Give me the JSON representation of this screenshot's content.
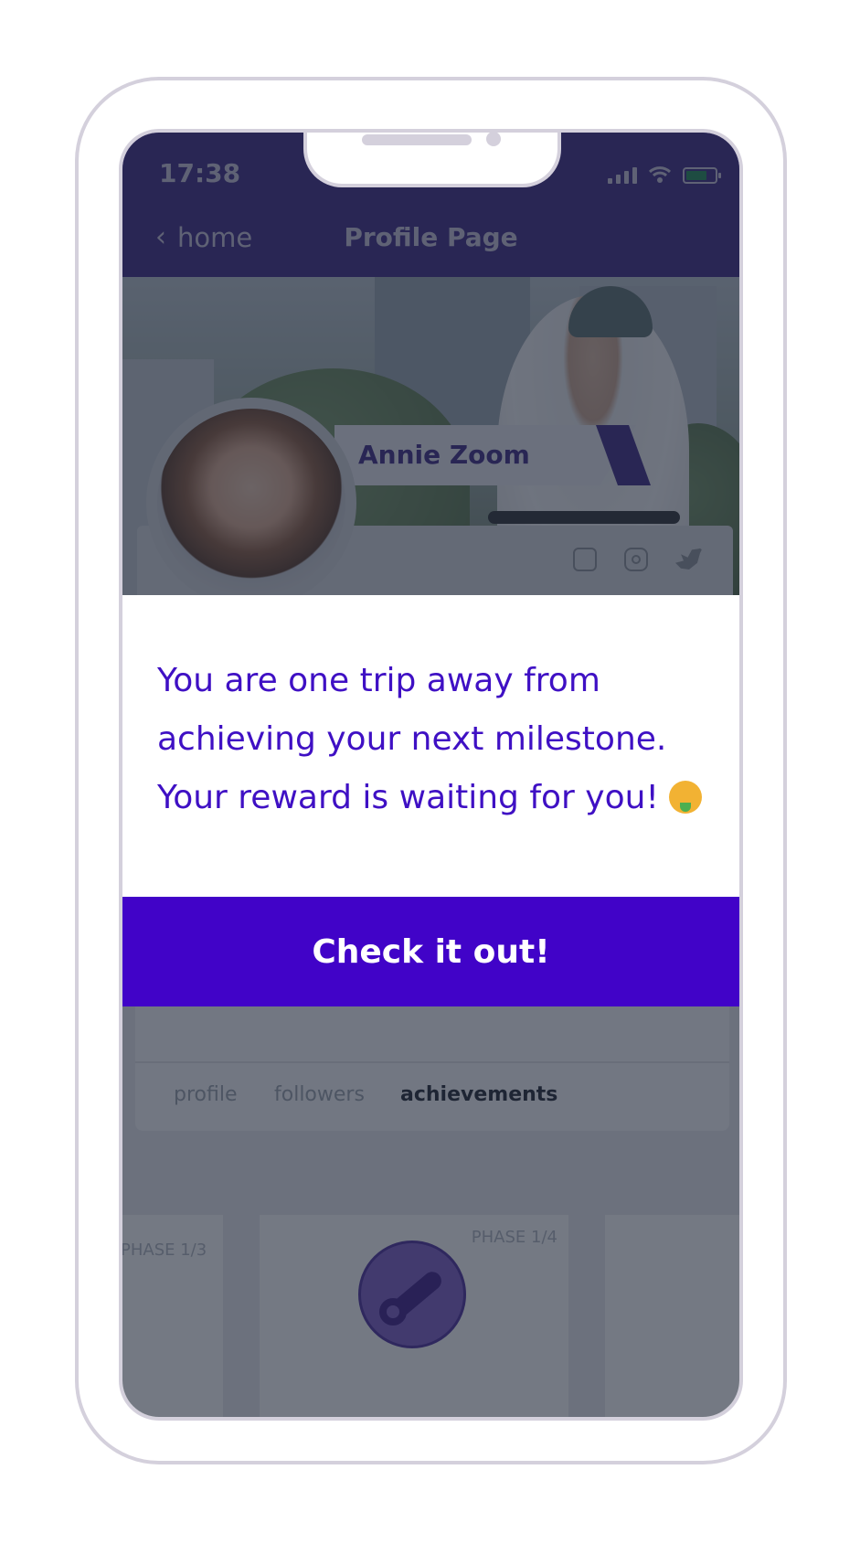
{
  "status_bar": {
    "time": "17:38"
  },
  "header": {
    "back_label": "home",
    "title": "Profile Page"
  },
  "profile": {
    "name": "Annie Zoom"
  },
  "modal": {
    "message": "You are one trip away from achieving your next milestone. Your reward is waiting for you!",
    "emoji": "money-mouth-face-emoji",
    "cta_label": "Check it out!"
  },
  "tabs": [
    {
      "label": "profile"
    },
    {
      "label": "followers"
    },
    {
      "label": "achievements",
      "active": true
    }
  ],
  "phases": {
    "left": "PHASE 1/3",
    "mid": "PHASE 1/4"
  },
  "colors": {
    "header": "#3b2785",
    "accent": "#4103c8",
    "text_accent": "#3f10c4"
  }
}
